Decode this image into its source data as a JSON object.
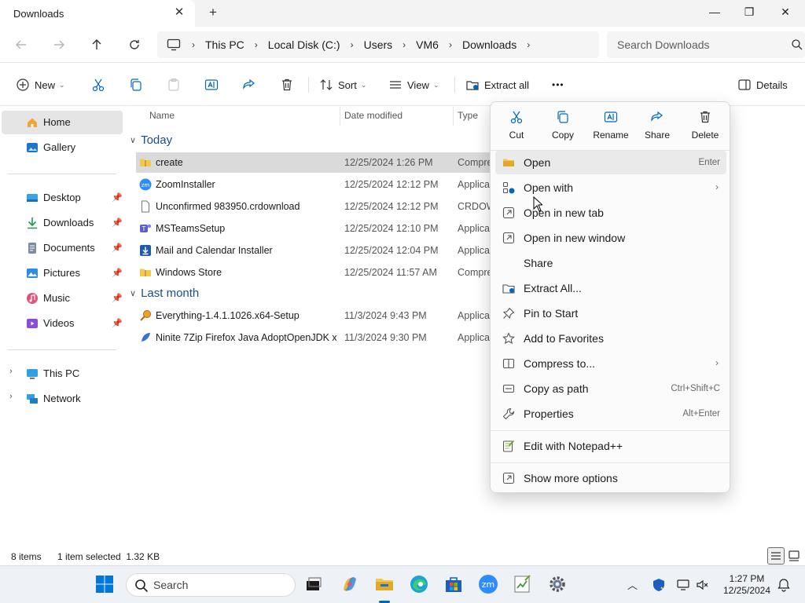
{
  "window": {
    "tab_title": "Downloads",
    "tab_close": "✕",
    "new_tab": "+",
    "min": "—",
    "max": "❐",
    "close": "✕"
  },
  "address": {
    "crumbs": [
      "This PC",
      "Local Disk (C:)",
      "Users",
      "VM6",
      "Downloads"
    ],
    "search_placeholder": "Search Downloads"
  },
  "toolbar": {
    "new_label": "New",
    "sort_label": "Sort",
    "view_label": "View",
    "extract_label": "Extract all",
    "more_label": "•••",
    "details_label": "Details"
  },
  "sidebar": {
    "items": [
      {
        "label": "Home"
      },
      {
        "label": "Gallery"
      },
      {
        "label": "Desktop"
      },
      {
        "label": "Downloads"
      },
      {
        "label": "Documents"
      },
      {
        "label": "Pictures"
      },
      {
        "label": "Music"
      },
      {
        "label": "Videos"
      },
      {
        "label": "This PC"
      },
      {
        "label": "Network"
      }
    ]
  },
  "filelist": {
    "columns": {
      "name": "Name",
      "date": "Date modified",
      "type": "Type"
    },
    "groups": [
      "Today",
      "Last month"
    ],
    "rows": [
      {
        "name": "create",
        "date": "12/25/2024 1:26 PM",
        "type": "Compre"
      },
      {
        "name": "ZoomInstaller",
        "date": "12/25/2024 12:12 PM",
        "type": "Applica"
      },
      {
        "name": "Unconfirmed 983950.crdownload",
        "date": "12/25/2024 12:12 PM",
        "type": "CRDOW"
      },
      {
        "name": "MSTeamsSetup",
        "date": "12/25/2024 12:10 PM",
        "type": "Applica"
      },
      {
        "name": "Mail and Calendar Installer",
        "date": "12/25/2024 12:04 PM",
        "type": "Applica"
      },
      {
        "name": "Windows Store",
        "date": "12/25/2024 11:57 AM",
        "type": "Compre"
      },
      {
        "name": "Everything-1.4.1.1026.x64-Setup",
        "date": "11/3/2024 9:43 PM",
        "type": "Applica"
      },
      {
        "name": "Ninite 7Zip Firefox Java AdoptOpenJDK x...",
        "date": "11/3/2024 9:30 PM",
        "type": "Applica"
      }
    ]
  },
  "status": {
    "count": "8 items",
    "selection": "1 item selected  1.32 KB"
  },
  "context_menu": {
    "quick_actions": [
      {
        "label": "Cut"
      },
      {
        "label": "Copy"
      },
      {
        "label": "Rename"
      },
      {
        "label": "Share"
      },
      {
        "label": "Delete"
      }
    ],
    "items": [
      {
        "label": "Open",
        "key": "Enter"
      },
      {
        "label": "Open with",
        "arrow": "›"
      },
      {
        "label": "Open in new tab"
      },
      {
        "label": "Open in new window"
      },
      {
        "label": "Share"
      },
      {
        "label": "Extract All..."
      },
      {
        "label": "Pin to Start"
      },
      {
        "label": "Add to Favorites"
      },
      {
        "label": "Compress to...",
        "arrow": "›"
      },
      {
        "label": "Copy as path",
        "key": "Ctrl+Shift+C"
      },
      {
        "label": "Properties",
        "key": "Alt+Enter"
      },
      {
        "label": "Edit with Notepad++"
      },
      {
        "label": "Show more options"
      }
    ]
  },
  "taskbar": {
    "search_label": "Search",
    "time": "1:27 PM",
    "date": "12/25/2024"
  },
  "colors": {
    "accent": "#0067c0",
    "folder": "#f2c94c",
    "selection": "#dadada",
    "group_heading": "#1a4d8c"
  }
}
